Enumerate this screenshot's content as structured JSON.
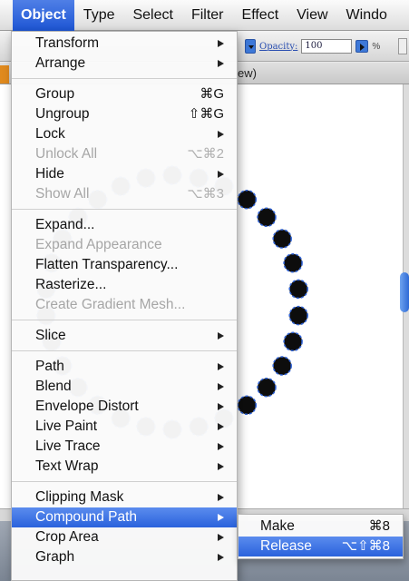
{
  "menubar": {
    "items": [
      "Object",
      "Type",
      "Select",
      "Filter",
      "Effect",
      "View",
      "Windo"
    ],
    "active_index": 0
  },
  "control_bar": {
    "opacity_label": "Opacity:",
    "opacity_value": "100",
    "percent_symbol": "%"
  },
  "document_tab": {
    "label_fragment": "ew)"
  },
  "object_menu": {
    "groups": [
      [
        {
          "label": "Transform",
          "submenu": true
        },
        {
          "label": "Arrange",
          "submenu": true
        }
      ],
      [
        {
          "label": "Group",
          "shortcut": "⌘G"
        },
        {
          "label": "Ungroup",
          "shortcut": "⇧⌘G"
        },
        {
          "label": "Lock",
          "submenu": true
        },
        {
          "label": "Unlock All",
          "shortcut": "⌥⌘2",
          "disabled": true
        },
        {
          "label": "Hide",
          "submenu": true
        },
        {
          "label": "Show All",
          "shortcut": "⌥⌘3",
          "disabled": true
        }
      ],
      [
        {
          "label": "Expand..."
        },
        {
          "label": "Expand Appearance",
          "disabled": true
        },
        {
          "label": "Flatten Transparency..."
        },
        {
          "label": "Rasterize..."
        },
        {
          "label": "Create Gradient Mesh...",
          "disabled": true
        }
      ],
      [
        {
          "label": "Slice",
          "submenu": true
        }
      ],
      [
        {
          "label": "Path",
          "submenu": true
        },
        {
          "label": "Blend",
          "submenu": true
        },
        {
          "label": "Envelope Distort",
          "submenu": true
        },
        {
          "label": "Live Paint",
          "submenu": true
        },
        {
          "label": "Live Trace",
          "submenu": true
        },
        {
          "label": "Text Wrap",
          "submenu": true
        }
      ],
      [
        {
          "label": "Clipping Mask",
          "submenu": true
        },
        {
          "label": "Compound Path",
          "submenu": true,
          "highlighted": true
        },
        {
          "label": "Crop Area",
          "submenu": true
        },
        {
          "label": "Graph",
          "submenu": true
        }
      ]
    ]
  },
  "compound_path_submenu": {
    "items": [
      {
        "label": "Make",
        "shortcut": "⌘8"
      },
      {
        "label": "Release",
        "shortcut": "⌥⇧⌘8",
        "highlighted": true
      }
    ]
  },
  "colors": {
    "menu_highlight": "#2a62dc",
    "selection_blue": "#2f63d8",
    "dot_fill": "#0d0d0d"
  }
}
